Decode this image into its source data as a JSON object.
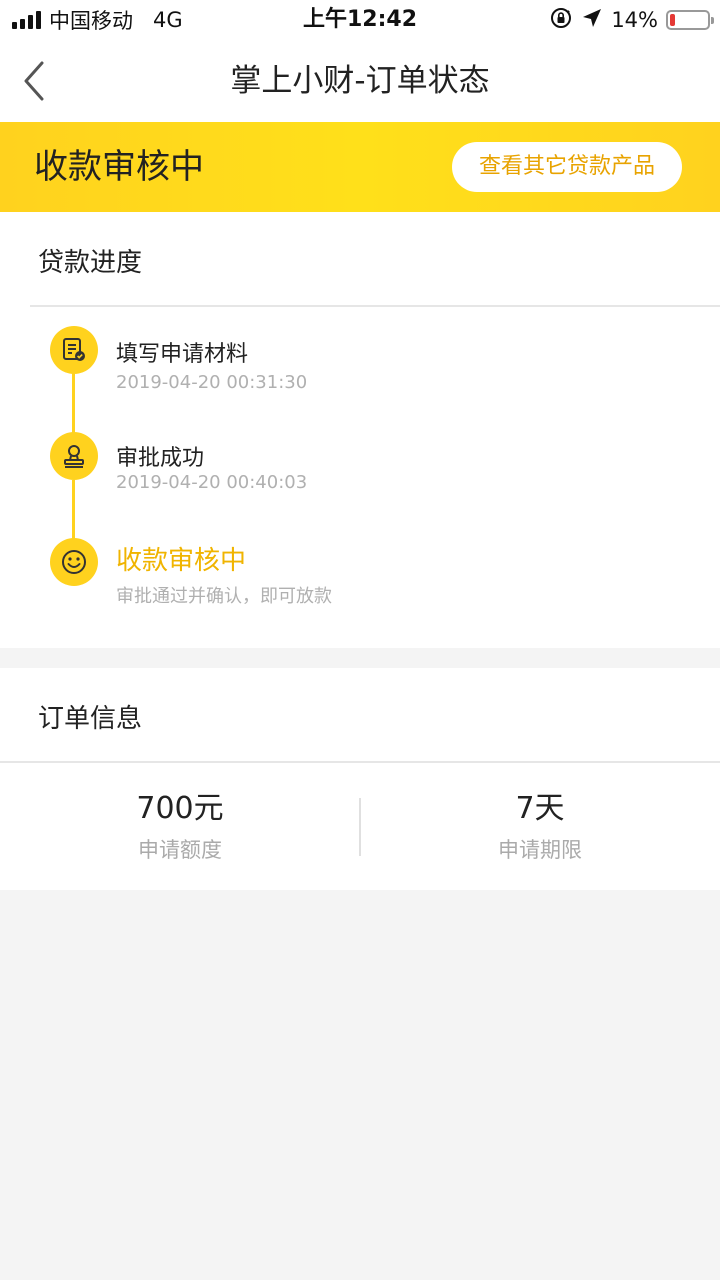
{
  "status_bar": {
    "carrier": "中国移动",
    "network": "4G",
    "time": "上午12:42",
    "battery_percent": "14%",
    "battery_level": 0.14
  },
  "nav": {
    "title": "掌上小财-订单状态",
    "back_icon": "chevron-left-icon"
  },
  "banner": {
    "status": "收款审核中",
    "button_label": "查看其它贷款产品",
    "accent": "#ffd21e"
  },
  "progress": {
    "title": "贷款进度",
    "steps": [
      {
        "title": "填写申请材料",
        "subtitle": "2019-04-20 00:31:30",
        "icon": "document-check-icon"
      },
      {
        "title": "审批成功",
        "subtitle": "2019-04-20 00:40:03",
        "icon": "stamp-icon"
      },
      {
        "title": "收款审核中",
        "subtitle": "审批通过并确认，即可放款",
        "icon": "smile-icon",
        "active": true
      }
    ]
  },
  "order": {
    "title": "订单信息",
    "amount_value": "700元",
    "amount_label": "申请额度",
    "term_value": "7天",
    "term_label": "申请期限"
  },
  "colors": {
    "active_text": "#f0b400",
    "button_text": "#e8a300",
    "background": "#f4f4f4"
  }
}
